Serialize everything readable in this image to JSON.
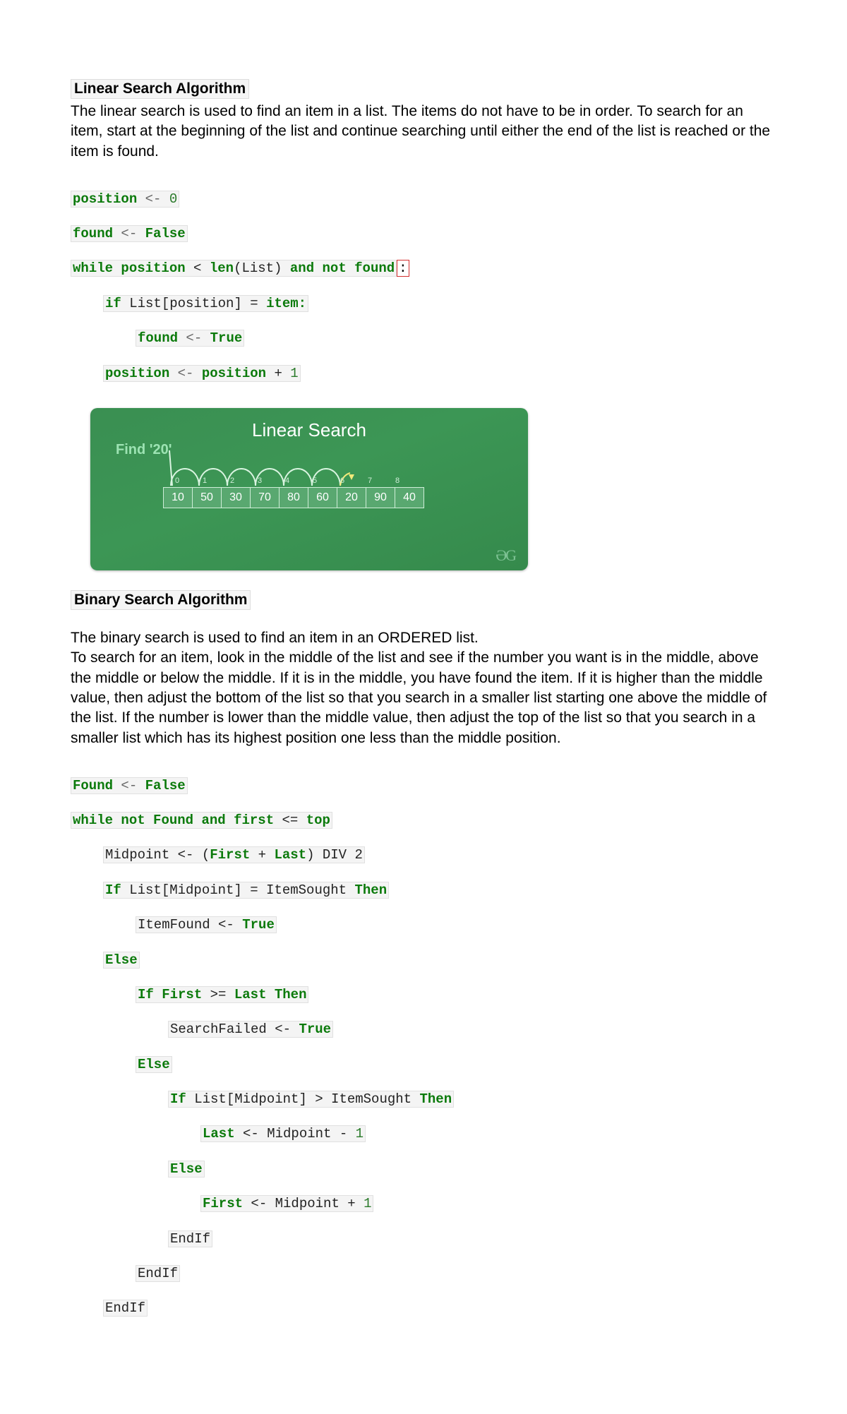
{
  "section1": {
    "heading": "Linear Search Algorithm",
    "paragraph": "The linear search is used to find an item in a list. The items do not have to be in order. To search for an item, start at the beginning of the list and continue searching until either the end of the list is reached or the item is found."
  },
  "code1": {
    "l1a": "position",
    "l1b": "<-",
    "l1c": "0",
    "l2a": "found",
    "l2b": "<-",
    "l2c": "False",
    "l3a": "while",
    "l3b": "position",
    "l3c": "<",
    "l3d": "len",
    "l3e": "(List)",
    "l3f": "and",
    "l3g": "not",
    "l3h": "found",
    "l3i": ":",
    "l4a": "if",
    "l4b": "List[position] =",
    "l4c": "item:",
    "l5a": "found",
    "l5b": "<-",
    "l5c": "True",
    "l6a": "position",
    "l6b": "<-",
    "l6c": "position",
    "l6d": "+",
    "l6e": "1"
  },
  "diagram": {
    "title": "Linear Search",
    "find": "Find '20'",
    "indices": [
      "0",
      "1",
      "2",
      "3",
      "4",
      "5",
      "6",
      "7",
      "8"
    ],
    "values": [
      "10",
      "50",
      "30",
      "70",
      "80",
      "60",
      "20",
      "90",
      "40"
    ],
    "watermark": "ƏG"
  },
  "section2": {
    "heading": "Binary Search Algorithm",
    "p1": "The binary search is used to find an item in an ORDERED list.",
    "p2": "To search for an item, look in the middle of the list and see if the number you want is in the middle, above the middle or below the middle. If it is in the middle, you have found the item. If it is higher than the middle value, then adjust the bottom of the list so that you search in a smaller list starting one above the middle of the list. If the number is lower than the middle value, then adjust the top of the list so that you search in a smaller list which has its highest position one less than the middle position."
  },
  "code2": {
    "l1a": "Found",
    "l1b": "<-",
    "l1c": "False",
    "l2a": "while",
    "l2b": "not",
    "l2c": "Found",
    "l2d": "and",
    "l2e": "first",
    "l2f": "<=",
    "l2g": "top",
    "l3a": "Midpoint <- (",
    "l3b": "First",
    "l3c": "+",
    "l3d": "Last",
    "l3e": ") DIV 2",
    "l4a": "If",
    "l4b": "List[Midpoint] = ItemSought",
    "l4c": "Then",
    "l5a": "ItemFound <-",
    "l5b": "True",
    "l6a": "Else",
    "l7a": "If",
    "l7b": "First",
    "l7c": ">=",
    "l7d": "Last",
    "l7e": "Then",
    "l8a": "SearchFailed <-",
    "l8b": "True",
    "l9a": "Else",
    "l10a": "If",
    "l10b": "List[Midpoint] > ItemSought",
    "l10c": "Then",
    "l11a": "Last",
    "l11b": "<- Midpoint -",
    "l11c": "1",
    "l12a": "Else",
    "l13a": "First",
    "l13b": "<- Midpoint +",
    "l13c": "1",
    "l14a": "EndIf",
    "l15a": "EndIf",
    "l16a": "EndIf"
  }
}
